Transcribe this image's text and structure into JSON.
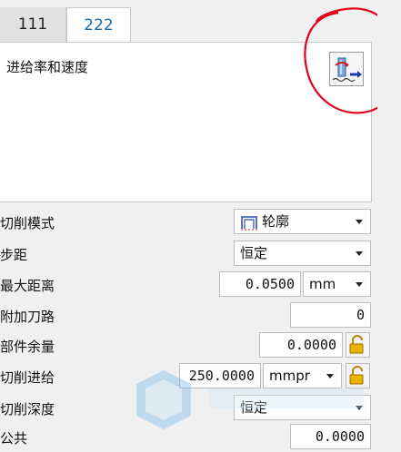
{
  "tabs": [
    {
      "label": "111",
      "active": false
    },
    {
      "label": "222",
      "active": true
    }
  ],
  "panel": {
    "title": "进给率和速度",
    "icon": "feed-speed-icon"
  },
  "form": {
    "cut_pattern": {
      "label": "切削模式",
      "value": "轮廓",
      "icon": "contour-pattern-icon"
    },
    "stepover": {
      "label": "步距",
      "value": "恒定"
    },
    "max_distance": {
      "label": "最大距离",
      "value": "0.0500",
      "unit": "mm"
    },
    "additional_passes": {
      "label": "附加刀路",
      "value": "0"
    },
    "part_stock": {
      "label": "部件余量",
      "value": "0.0000"
    },
    "cut_feed": {
      "label": "切削进给",
      "value": "250.0000",
      "unit": "mmpr"
    },
    "depth_of_cut": {
      "label": "切削深度",
      "value": "恒定"
    },
    "common": {
      "label": "公共",
      "value": "0.0000"
    }
  },
  "colors": {
    "active_tab_text": "#1b6ea8",
    "annotation": "#e0001a",
    "lock": "#d9a300"
  }
}
